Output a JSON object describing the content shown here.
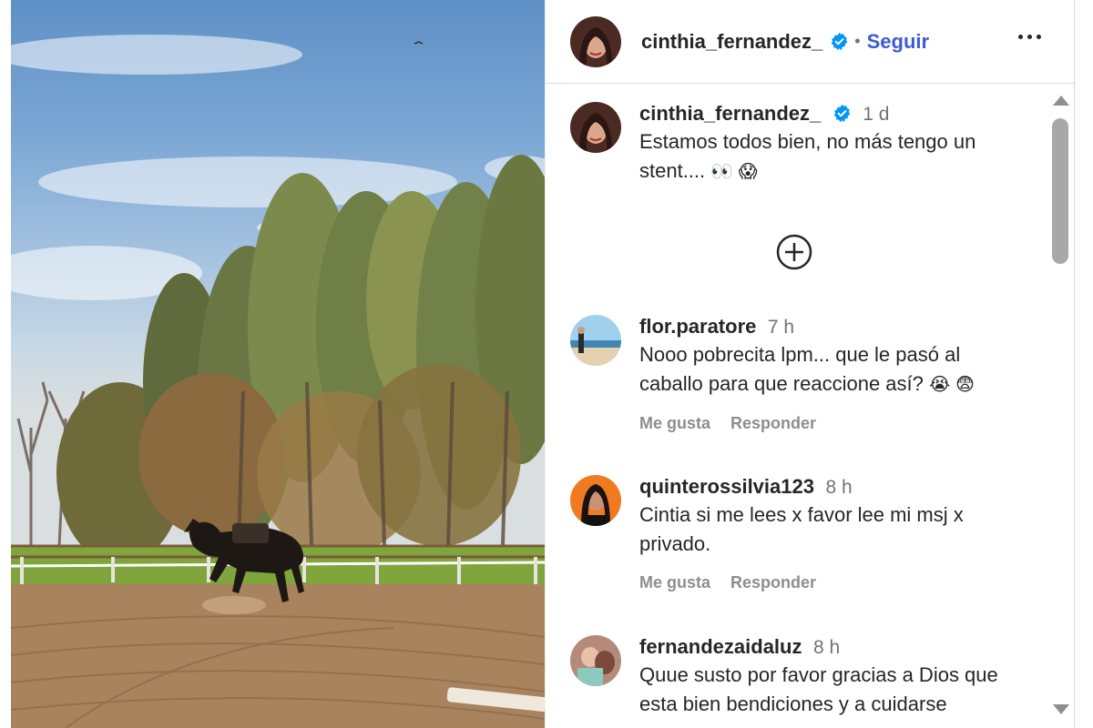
{
  "post": {
    "author": "cinthia_fernandez_",
    "verified": true,
    "follow_label": "Seguir",
    "separator": "•",
    "more_icon": "more-horizontal-icon"
  },
  "caption": {
    "username": "cinthia_fernandez_",
    "time": "1 d",
    "text": "Estamos todos bien, no más tengo un stent....",
    "emojis": "👀 😱"
  },
  "load_more_icon": "plus-circle-icon",
  "comments": [
    {
      "username": "flor.paratore",
      "time": "7 h",
      "text": "Nooo pobrecita lpm... que le pasó al caballo para que reaccione así?",
      "emojis": "😭 😨",
      "like_label": "Me gusta",
      "reply_label": "Responder"
    },
    {
      "username": "quinterossilvia123",
      "time": "8 h",
      "text": "Cintia si me lees x favor lee mi msj x privado.",
      "emojis": "",
      "like_label": "Me gusta",
      "reply_label": "Responder"
    },
    {
      "username": "fernandezaidaluz",
      "time": "8 h",
      "text": "Quue susto por favor gracias a Dios que esta bien bendiciones y a cuidarse",
      "emojis": ""
    }
  ],
  "colors": {
    "accent": "#3a5bd9",
    "verified": "#0095f6",
    "text": "#262626",
    "muted": "#737373"
  }
}
